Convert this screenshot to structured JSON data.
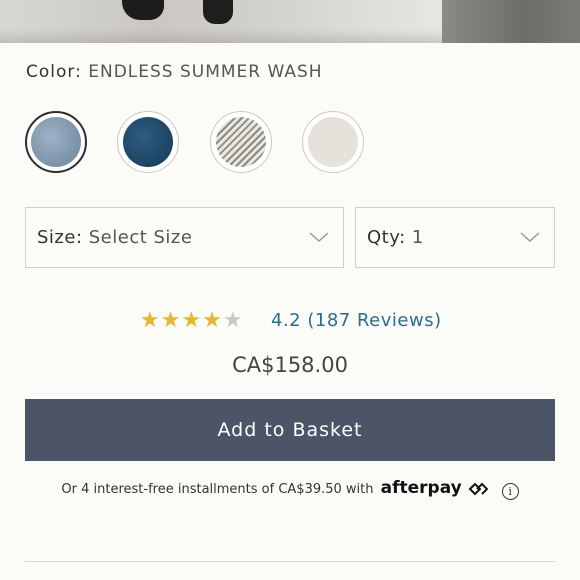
{
  "color": {
    "label": "Color:",
    "value": "ENDLESS SUMMER WASH"
  },
  "swatches": [
    {
      "name": "light-wash-swatch",
      "selected": true
    },
    {
      "name": "dark-wash-swatch",
      "selected": false
    },
    {
      "name": "striped-swatch",
      "selected": false
    },
    {
      "name": "ecru-swatch",
      "selected": false
    }
  ],
  "size": {
    "label": "Size:",
    "value": "Select Size"
  },
  "qty": {
    "label": "Qty:",
    "value": "1"
  },
  "rating": {
    "stars": "★★★★",
    "empty_star": "★",
    "value": "4.2",
    "reviews_text": "(187 Reviews)",
    "fraction": 0.84
  },
  "price": "CA$158.00",
  "add_button": "Add to Basket",
  "installments": {
    "text": "Or 4 interest-free installments of CA$39.50 with",
    "brand": "afterpay",
    "info": "i"
  },
  "colors": {
    "button_bg": "#4b5567",
    "star": "#e9b72e",
    "link": "#2b6d8f"
  }
}
